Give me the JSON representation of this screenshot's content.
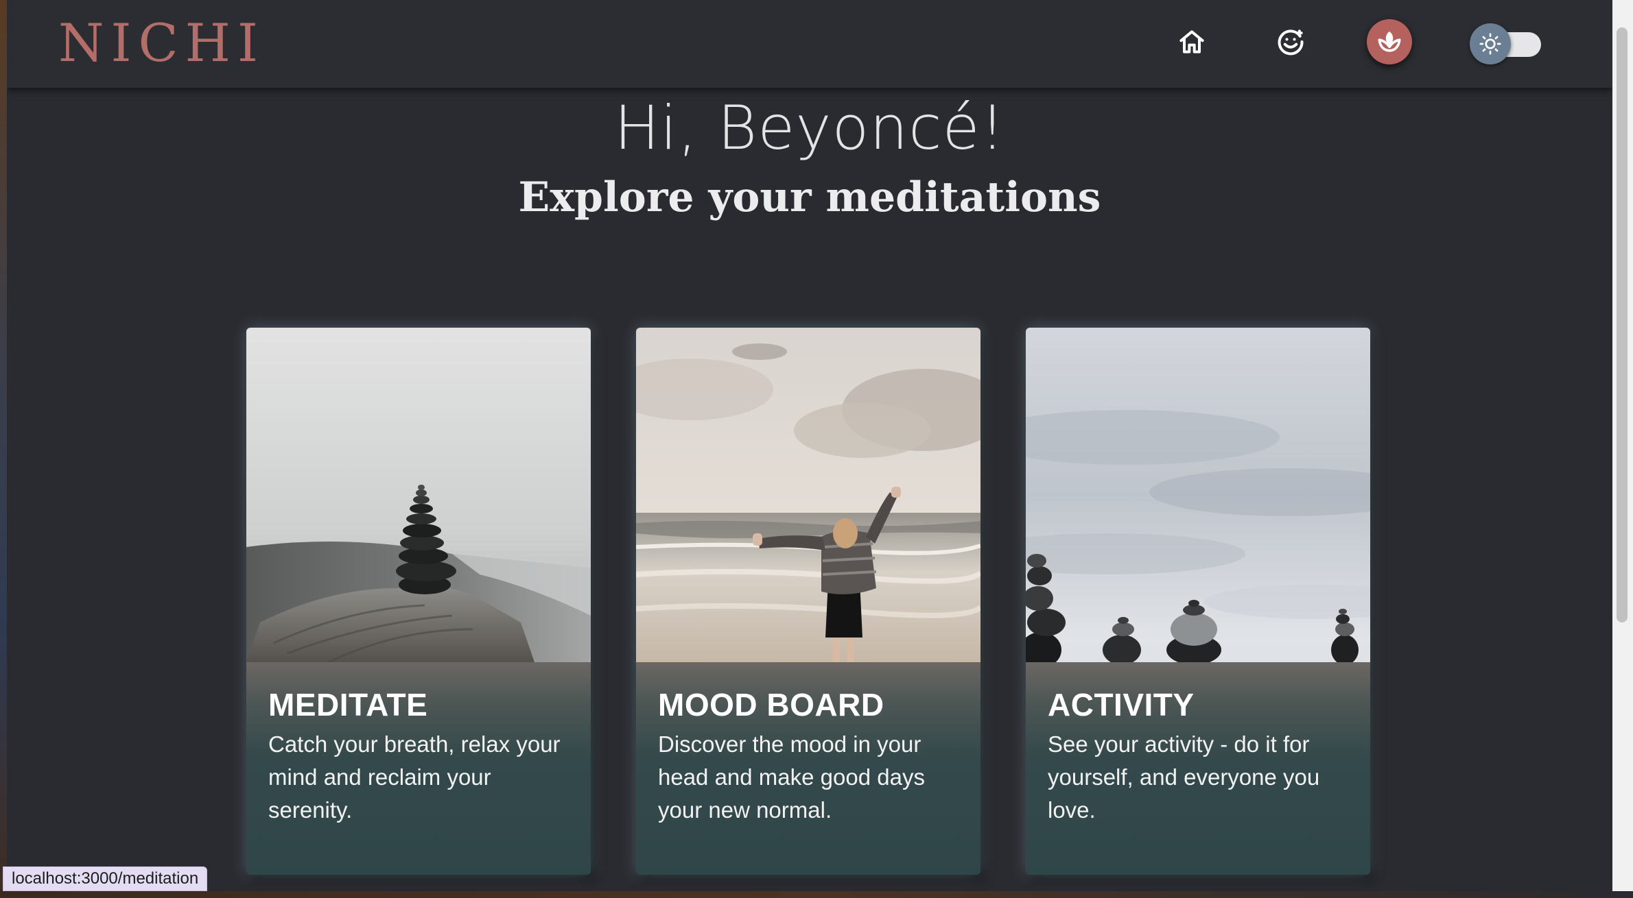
{
  "header": {
    "logo": "NICHI",
    "nav": [
      {
        "name": "home",
        "icon": "home-icon"
      },
      {
        "name": "mood",
        "icon": "smiley-icon"
      },
      {
        "name": "meditation",
        "icon": "lotus-icon",
        "active": true
      }
    ],
    "theme_toggle": {
      "icon": "sun-icon",
      "mode": "dark"
    }
  },
  "main": {
    "greeting": "Hi, Beyoncé!",
    "subtitle": "Explore your meditations"
  },
  "cards": [
    {
      "title": "MEDITATE",
      "description": "Catch your breath, relax your mind and reclaim your serenity.",
      "image": "stacked stones on driftwood by a foggy shore"
    },
    {
      "title": "MOOD BOARD",
      "description": "Discover the mood in your head and make good days your new normal.",
      "image": "person with arms raised facing the ocean"
    },
    {
      "title": "ACTIVITY",
      "description": "See your activity - do it for yourself, and everyone you love.",
      "image": "balanced pebbles against misty sea"
    }
  ],
  "status_bar": {
    "url": "localhost:3000/meditation"
  },
  "colors": {
    "background": "#2a2b30",
    "logo": "#b46e6a",
    "active_nav": "#b5615d",
    "toggle_knob": "#6b7f94",
    "card_body": "#2f4649"
  }
}
